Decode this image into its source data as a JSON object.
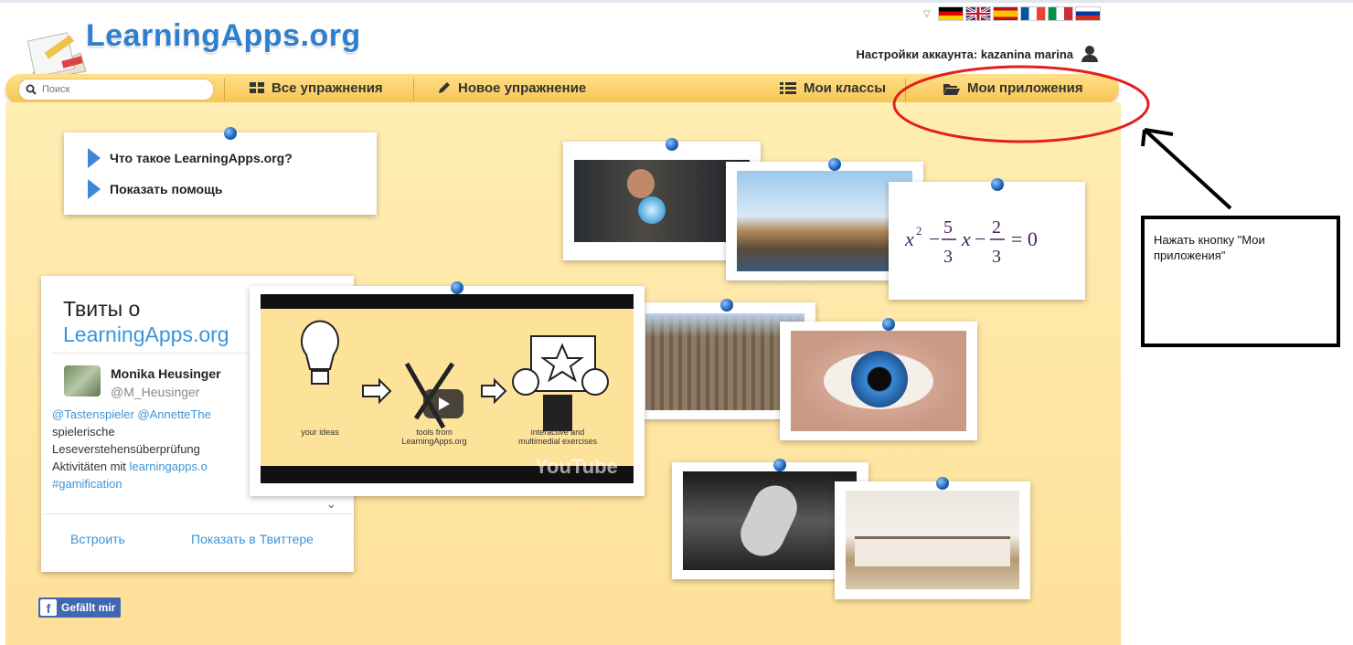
{
  "header": {
    "logo_text": "LearningApps.org",
    "account_label": "Настройки аккаунта: kazanina marina"
  },
  "flags": [
    "de-flag-icon",
    "gb-flag-icon",
    "es-flag-icon",
    "fr-flag-icon",
    "it-flag-icon",
    "ru-flag-icon"
  ],
  "nav": {
    "search_placeholder": "Поиск",
    "all_exercises": "Все упражнения",
    "new_exercise": "Новое упражнение",
    "my_classes": "Мои классы",
    "my_apps": "Мои приложения"
  },
  "help": {
    "what_is": "Что такое LearningApps.org?",
    "show_help": "Показать помощь"
  },
  "twitter": {
    "title_prefix": "Твиты о",
    "title_link": "LearningApps.org",
    "author_name": "Monika Heusinger",
    "author_handle": "@M_Heusinger",
    "tweet_mentions": "@Tastenspieler @AnnetteThe",
    "tweet_line1": "spielerische",
    "tweet_line2": "Leseverstehensüberprüfung",
    "tweet_line3_prefix": "Aktivitäten mit ",
    "tweet_line3_link": "learningapps.o",
    "tweet_hashtag": "#gamification",
    "embed": "Встроить",
    "view_on_twitter": "Показать в Твиттере"
  },
  "facebook": {
    "like_label": "Gefällt mir"
  },
  "video": {
    "caption_ideas": "your ideas",
    "caption_tools": "tools from LearningApps.org",
    "caption_interactive": "interactive and multimedial exercises",
    "watermark": "YouTube"
  },
  "math_card": {
    "equation": "x² − 5/3 x − 2/3 = 0"
  },
  "annotation": {
    "text": "Нажать кнопку \"Мои приложения\""
  },
  "colors": {
    "accent_blue": "#2f7fd0",
    "nav_yellow": "#f6c451",
    "board_bg": "#ffe6a4",
    "annotation_red": "#e02020"
  }
}
